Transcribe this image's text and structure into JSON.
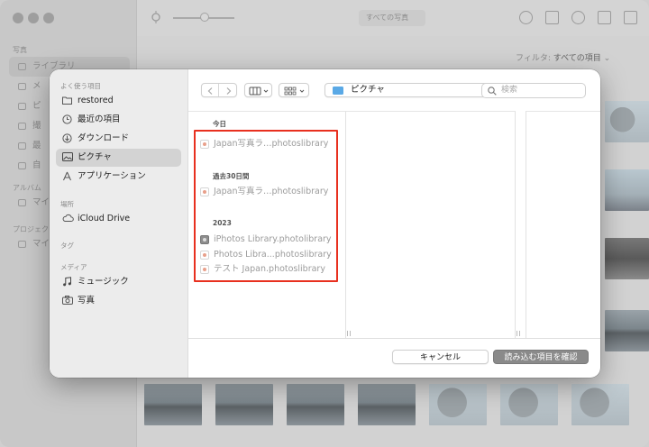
{
  "app": {
    "sidebar_section_photos": "写真",
    "sidebar_items": [
      "ライブラリ",
      "メ",
      "ピ",
      "撮",
      "最",
      "自"
    ],
    "sidebar_section_albums": "アルバム",
    "sidebar_album_item": "マイ",
    "sidebar_section_projects": "プロジェクト",
    "sidebar_project_item": "マイ",
    "toolbar_view_popup": "すべての写真",
    "filter_label": "フィルタ:",
    "filter_value": "すべての項目"
  },
  "dialog": {
    "sidebar": {
      "favorites_header": "よく使う項目",
      "favorites": [
        {
          "label": "restored",
          "icon": "folder-icon"
        },
        {
          "label": "最近の項目",
          "icon": "clock-icon"
        },
        {
          "label": "ダウンロード",
          "icon": "download-icon"
        },
        {
          "label": "ピクチャ",
          "icon": "pictures-icon"
        },
        {
          "label": "アプリケーション",
          "icon": "applications-icon"
        }
      ],
      "locations_header": "場所",
      "locations": [
        {
          "label": "iCloud Drive",
          "icon": "cloud-icon"
        }
      ],
      "tags_header": "タグ",
      "media_header": "メディア",
      "media": [
        {
          "label": "ミュージック",
          "icon": "music-icon"
        },
        {
          "label": "写真",
          "icon": "camera-icon"
        }
      ]
    },
    "location": "ピクチャ",
    "search_placeholder": "検索",
    "groups": [
      {
        "title": "今日",
        "files": [
          "Japan写真ラ…photoslibrary"
        ]
      },
      {
        "title": "過去30日間",
        "files": [
          "Japan写真ラ…photoslibrary"
        ]
      },
      {
        "title": "2023",
        "files": [
          "iPhotos Library.photolibrary",
          "Photos Libra...photoslibrary",
          "テスト Japan.photoslibrary"
        ]
      }
    ],
    "cancel_label": "キャンセル",
    "confirm_label": "読み込む項目を確認"
  },
  "colors": {
    "highlight": "#e8301f",
    "selected_sidebar": "#d3d3d3",
    "folder_blue": "#5aa9e6"
  }
}
